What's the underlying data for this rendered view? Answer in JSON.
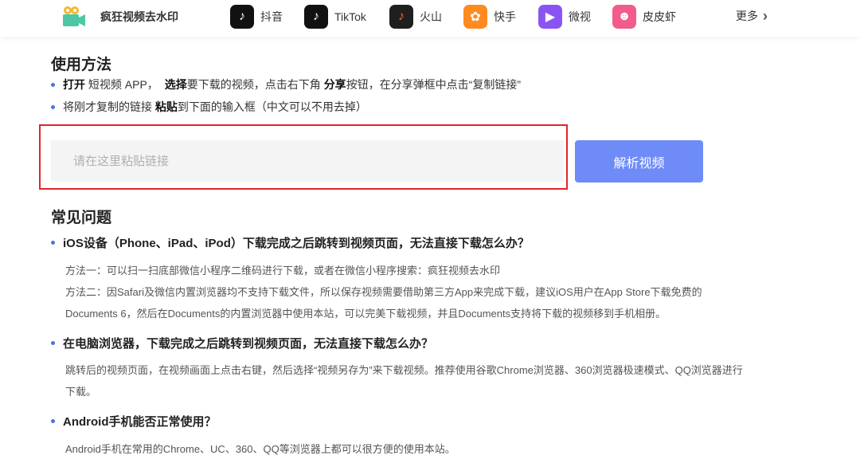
{
  "header": {
    "brand": "疯狂视频去水印",
    "nav": [
      {
        "label": "抖音",
        "icon": "douyin-icon",
        "color": "#111111",
        "glyph": "♪"
      },
      {
        "label": "TikTok",
        "icon": "tiktok-icon",
        "color": "#111111",
        "glyph": "♪"
      },
      {
        "label": "火山",
        "icon": "huoshan-icon",
        "color": "#1f1f1f",
        "glyph": "♪"
      },
      {
        "label": "快手",
        "icon": "kuaishou-icon",
        "color": "#ff8a1f",
        "glyph": "✿"
      },
      {
        "label": "微视",
        "icon": "weishi-icon",
        "color": "#8a54f5",
        "glyph": "▶"
      },
      {
        "label": "皮皮虾",
        "icon": "pipixia-icon",
        "color": "#f25c8a",
        "glyph": "☻"
      }
    ],
    "more": "更多"
  },
  "usage": {
    "title": "使用方法",
    "step1": {
      "open": "打开",
      "t1": " 短视频 APP，",
      "select": "选择",
      "t2": "要下载的视频，点击右下角 ",
      "share": "分享",
      "t3": "按钮，在分享弹框中点击“复制链接”"
    },
    "step2": {
      "t1": "将刚才复制的链接 ",
      "paste": "粘贴",
      "t2": "到下面的输入框（中文可以不用去掉）"
    }
  },
  "form": {
    "placeholder": "请在这里粘贴链接",
    "button": "解析视频"
  },
  "faq": {
    "title": "常见问题",
    "q1": "iOS设备（Phone、iPad、iPod）下载完成之后跳转到视频页面，无法直接下载怎么办？",
    "a1_1": "方法一：可以扫一扫底部微信小程序二维码进行下载，或者在微信小程序搜索：疯狂视频去水印",
    "a1_2": "方法二：因Safari及微信内置浏览器均不支持下载文件，所以保存视频需要借助第三方App来完成下载，建议iOS用户在App Store下载免费的",
    "a1_3": "Documents 6，然后在Documents的内置浏览器中使用本站，可以完美下载视频，并且Documents支持将下载的视频移到手机相册。",
    "q2": "在电脑浏览器，下载完成之后跳转到视频页面，无法直接下载怎么办？",
    "a2_1": "跳转后的视频页面，在视频画面上点击右键，然后选择“视频另存为”来下载视频。推荐使用谷歌Chrome浏览器、360浏览器极速模式、QQ浏览器进行",
    "a2_2": "下载。",
    "q3": "Android手机能否正常使用？",
    "a3_1": "Android手机在常用的Chrome、UC、360、QQ等浏览器上都可以很方便的使用本站。"
  }
}
